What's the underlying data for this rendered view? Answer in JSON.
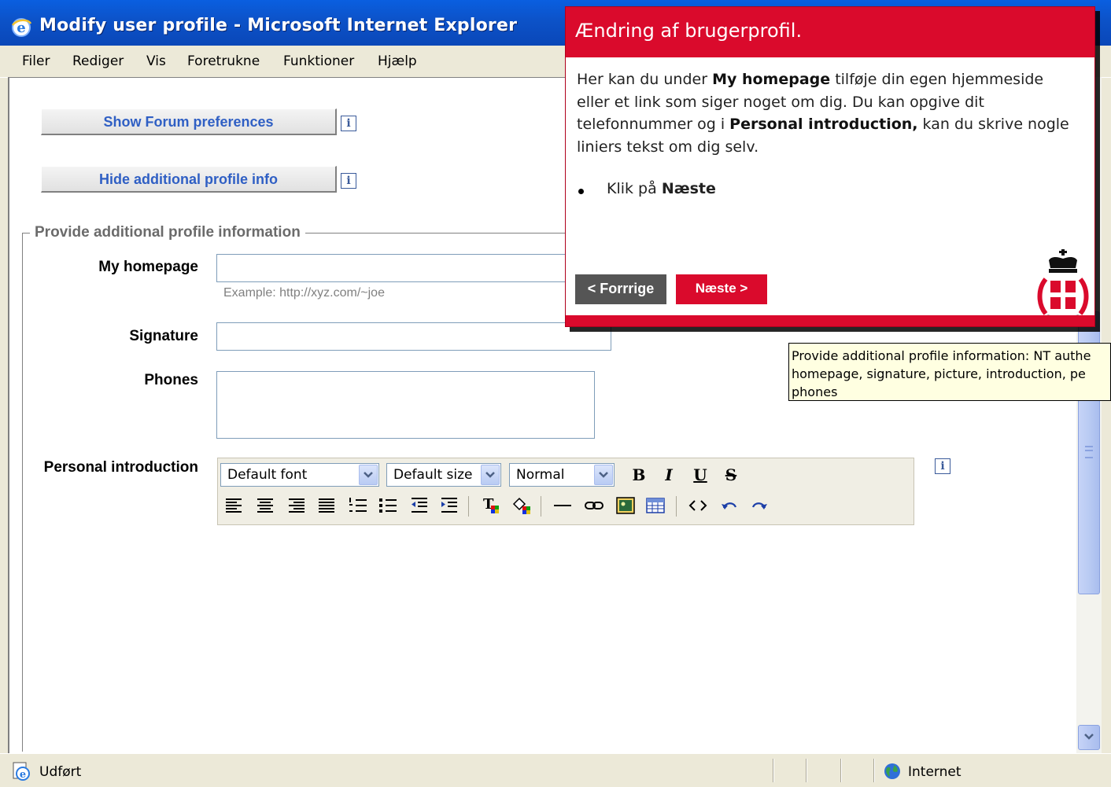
{
  "window": {
    "title": "Modify user profile - Microsoft Internet Explorer"
  },
  "menu": {
    "items": [
      "Filer",
      "Rediger",
      "Vis",
      "Foretrukne",
      "Funktioner",
      "Hjælp"
    ]
  },
  "buttons": {
    "show_forum": "Show Forum preferences",
    "hide_additional": "Hide additional profile info"
  },
  "form": {
    "legend": "Provide additional profile information",
    "homepage_label": "My homepage",
    "homepage_example": "Example: http://xyz.com/~joe",
    "signature_label": "Signature",
    "phones_label": "Phones",
    "intro_label": "Personal introduction"
  },
  "editor": {
    "font": "Default font",
    "size": "Default size",
    "format": "Normal",
    "bold": "B",
    "italic": "I",
    "underline": "U",
    "strike": "S"
  },
  "tooltip": {
    "line1": "Provide additional profile information: NT authe",
    "line2": "homepage, signature, picture, introduction, pe",
    "line3": "phones"
  },
  "help": {
    "title": "Ændring af brugerprofil.",
    "p1": "Her kan du under ",
    "p1_b1": "My homepage",
    "p1_2": " tilføje din egen hjemmeside eller et link som siger noget om dig. Du kan opgive dit telefonnummer og i ",
    "p1_b2": "Personal introduction,",
    "p1_3": " kan du skrive nogle liniers tekst om dig selv.",
    "bullet_text": "Klik på ",
    "bullet_bold": "Næste",
    "prev": "< Forrrige",
    "next": "Næste >"
  },
  "statusbar": {
    "status": "Udført",
    "zone": "Internet"
  },
  "colors": {
    "accent_red": "#da0a2c",
    "xp_blue": "#0c52c8",
    "link_blue": "#2f5fc4",
    "tooltip_bg": "#ffffe1"
  }
}
